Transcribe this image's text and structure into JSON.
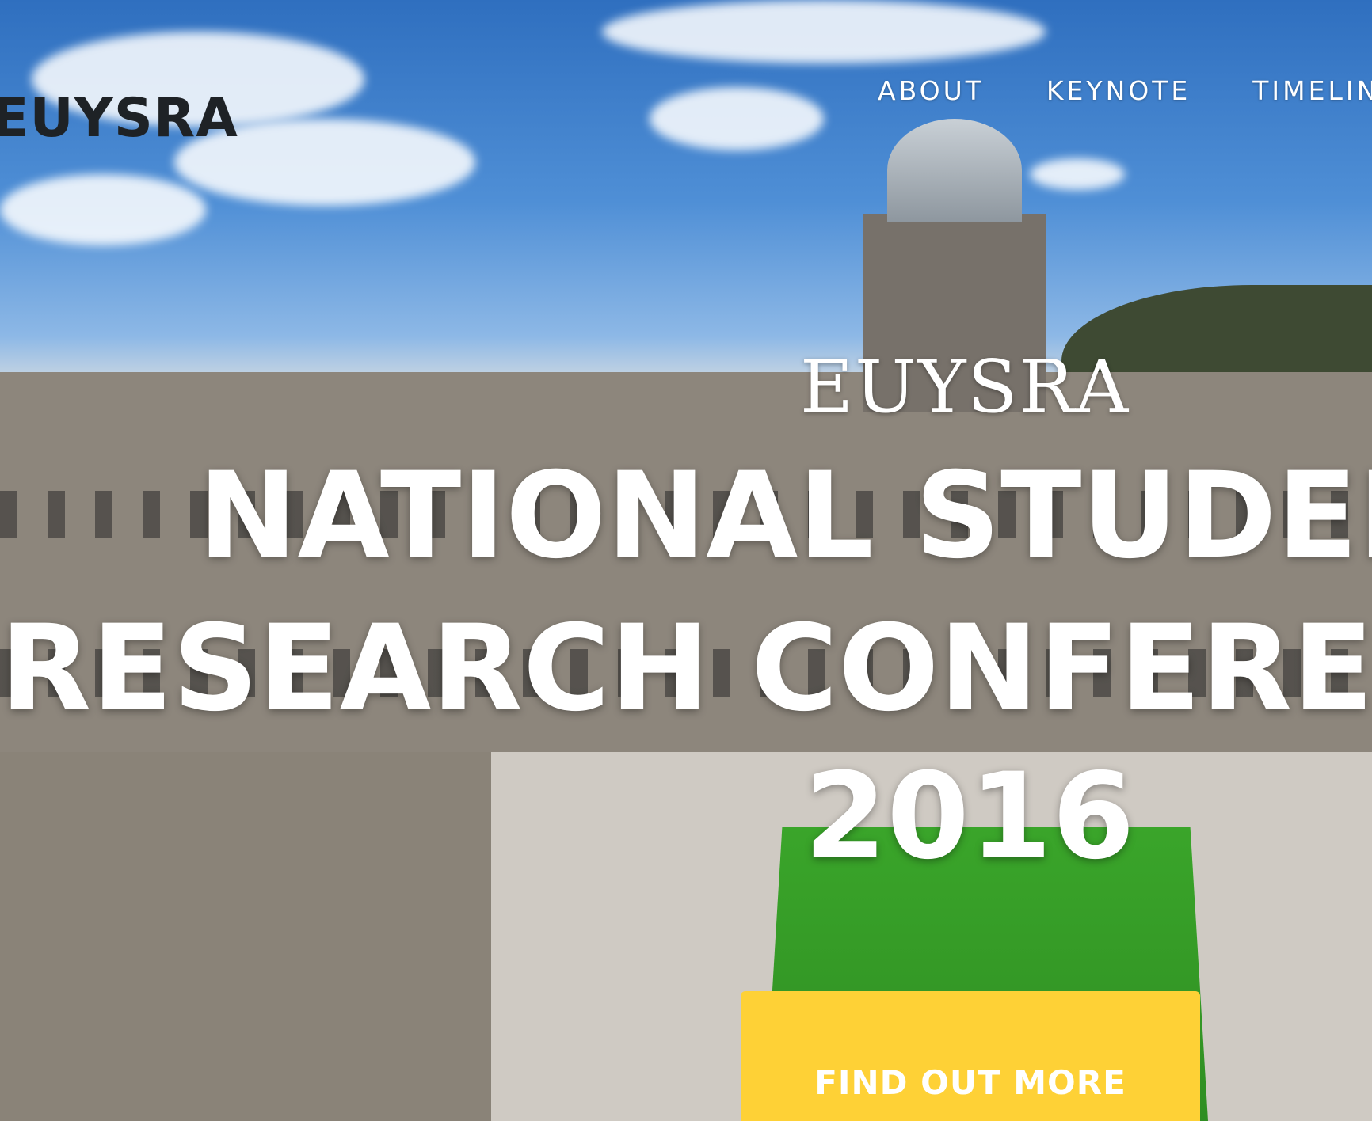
{
  "nav": {
    "logo": "EUYSRA",
    "items": [
      {
        "label": "ABOUT"
      },
      {
        "label": "KEYNOTE"
      },
      {
        "label": "TIMELINE"
      }
    ]
  },
  "hero": {
    "kicker": "EUYSRA",
    "headline_line1": "NATIONAL STUDENT",
    "headline_line2": "RESEARCH CONFERENCE",
    "headline_line3": "2016",
    "cta_label": "FIND OUT MORE"
  },
  "colors": {
    "cta": "#fed136",
    "text": "#ffffff",
    "logo": "#1e2226"
  }
}
